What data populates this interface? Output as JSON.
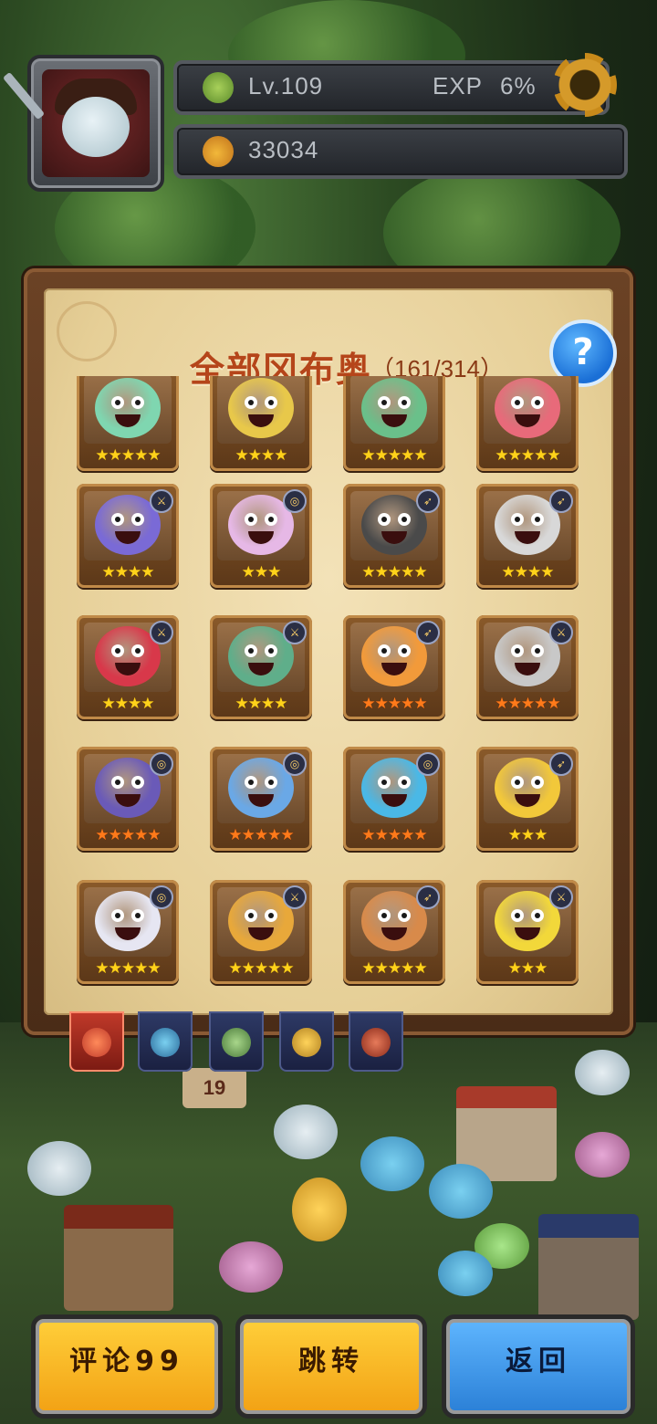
{
  "player": {
    "level_label": "Lv.109",
    "exp_label": "EXP",
    "exp_value": "6%",
    "gold": "33034"
  },
  "panel": {
    "title": "全部冈布奥",
    "count": "（161/314）",
    "help_symbol": "?"
  },
  "collection": {
    "rows": [
      [
        {
          "stars": 5,
          "color": "gold",
          "badge": ""
        },
        {
          "stars": 4,
          "color": "gold",
          "badge": ""
        },
        {
          "stars": 5,
          "color": "gold",
          "badge": ""
        },
        {
          "stars": 5,
          "color": "gold",
          "badge": ""
        }
      ],
      [
        {
          "stars": 4,
          "color": "gold",
          "badge": "sword"
        },
        {
          "stars": 3,
          "color": "gold",
          "badge": "swirl"
        },
        {
          "stars": 5,
          "color": "gold",
          "badge": "bow"
        },
        {
          "stars": 4,
          "color": "gold",
          "badge": "bow"
        }
      ],
      [
        {
          "stars": 4,
          "color": "gold",
          "badge": "sword"
        },
        {
          "stars": 4,
          "color": "gold",
          "badge": "sword"
        },
        {
          "stars": 5,
          "color": "orange",
          "badge": "bow"
        },
        {
          "stars": 5,
          "color": "orange",
          "badge": "sword"
        }
      ],
      [
        {
          "stars": 5,
          "color": "orange",
          "badge": "swirl"
        },
        {
          "stars": 5,
          "color": "orange",
          "badge": "swirl"
        },
        {
          "stars": 5,
          "color": "orange",
          "badge": "swirl"
        },
        {
          "stars": 3,
          "color": "gold",
          "badge": "bow"
        }
      ],
      [
        {
          "stars": 5,
          "color": "gold",
          "badge": "swirl"
        },
        {
          "stars": 5,
          "color": "gold",
          "badge": "sword"
        },
        {
          "stars": 5,
          "color": "gold",
          "badge": "bow"
        },
        {
          "stars": 3,
          "color": "gold",
          "badge": "sword"
        }
      ]
    ]
  },
  "tabs": [
    "all",
    "blue",
    "green",
    "yellow",
    "red"
  ],
  "village": {
    "sign": "19"
  },
  "buttons": {
    "comment": "评论99",
    "jump": "跳转",
    "back": "返回"
  }
}
